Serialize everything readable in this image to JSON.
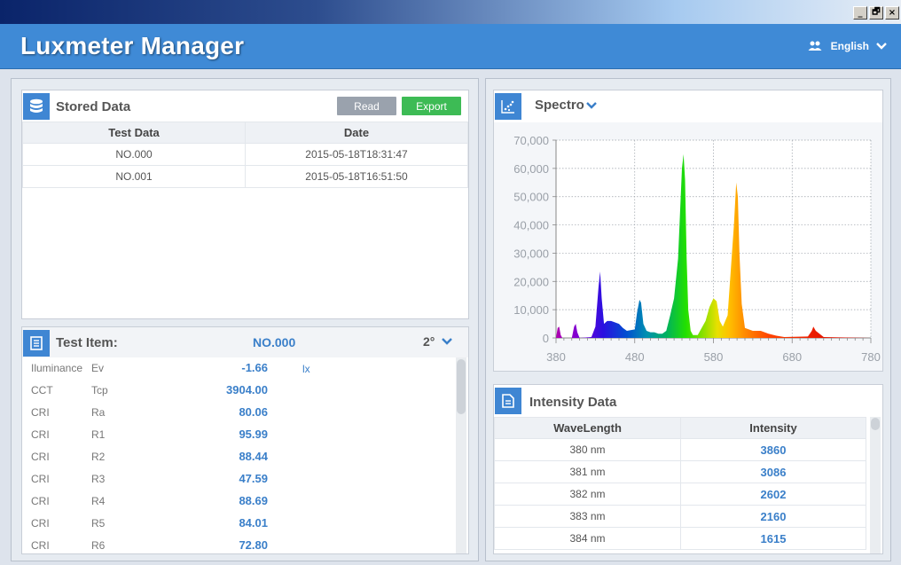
{
  "window": {
    "controls": [
      "_",
      "🗗",
      "×"
    ]
  },
  "header": {
    "title": "Luxmeter Manager",
    "language": "English"
  },
  "stored": {
    "title": "Stored Data",
    "read_label": "Read",
    "export_label": "Export",
    "columns": [
      "Test Data",
      "Date"
    ],
    "rows": [
      [
        "NO.000",
        "2015-05-18T18:31:47"
      ],
      [
        "NO.001",
        "2015-05-18T16:51:50"
      ]
    ]
  },
  "testitem": {
    "title": "Test Item:",
    "selected": "NO.000",
    "angle": "2°",
    "rows": [
      {
        "cat": "Iluminance",
        "sym": "Ev",
        "val": "-1.66",
        "unit": "lx"
      },
      {
        "cat": "CCT",
        "sym": "Tcp",
        "val": "3904.00",
        "unit": ""
      },
      {
        "cat": "CRI",
        "sym": "Ra",
        "val": "80.06",
        "unit": ""
      },
      {
        "cat": "CRI",
        "sym": "R1",
        "val": "95.99",
        "unit": ""
      },
      {
        "cat": "CRI",
        "sym": "R2",
        "val": "88.44",
        "unit": ""
      },
      {
        "cat": "CRI",
        "sym": "R3",
        "val": "47.59",
        "unit": ""
      },
      {
        "cat": "CRI",
        "sym": "R4",
        "val": "88.69",
        "unit": ""
      },
      {
        "cat": "CRI",
        "sym": "R5",
        "val": "84.01",
        "unit": ""
      },
      {
        "cat": "CRI",
        "sym": "R6",
        "val": "72.80",
        "unit": ""
      }
    ]
  },
  "spectro": {
    "title": "Spectro"
  },
  "chart_data": {
    "type": "area",
    "title": "",
    "xlabel": "",
    "ylabel": "",
    "xlim": [
      380,
      780
    ],
    "ylim": [
      0,
      70000
    ],
    "x_ticks": [
      "380",
      "480",
      "580",
      "680",
      "780"
    ],
    "y_ticks": [
      "0",
      "10,000",
      "20,000",
      "30,000",
      "40,000",
      "50,000",
      "60,000",
      "70,000"
    ],
    "grid": true,
    "series": [
      {
        "x": [
          380,
          382,
          384,
          386,
          388,
          400,
          403,
          405,
          407,
          410,
          425,
          430,
          434,
          436,
          438,
          441,
          445,
          450,
          455,
          460,
          465,
          470,
          480,
          483,
          486,
          488,
          491,
          495,
          500,
          505,
          510,
          515,
          520,
          525,
          530,
          535,
          540,
          542,
          544,
          546,
          548,
          551,
          554,
          560,
          570,
          575,
          580,
          584,
          588,
          592,
          598,
          606,
          609,
          611,
          613,
          616,
          620,
          625,
          630,
          640,
          650,
          660,
          670,
          700,
          705,
          707,
          710,
          720,
          740,
          780
        ],
        "y": [
          0,
          3500,
          4000,
          1000,
          0,
          0,
          4000,
          5000,
          2000,
          0,
          300,
          4000,
          18000,
          23500,
          14000,
          5000,
          6000,
          6000,
          5500,
          5000,
          3500,
          2500,
          3000,
          9000,
          13500,
          12500,
          5000,
          2500,
          2000,
          2000,
          1500,
          1500,
          2500,
          8000,
          14000,
          28000,
          60000,
          65000,
          56000,
          28000,
          10000,
          2500,
          1000,
          1000,
          6000,
          11000,
          14000,
          13000,
          6000,
          4000,
          8000,
          40000,
          55000,
          50000,
          30000,
          12000,
          3500,
          3000,
          2500,
          2500,
          1500,
          800,
          300,
          500,
          2500,
          4000,
          2500,
          300,
          200,
          0
        ]
      }
    ]
  },
  "intensity": {
    "title": "Intensity Data",
    "columns": [
      "WaveLength",
      "Intensity"
    ],
    "rows": [
      [
        "380 nm",
        "3860"
      ],
      [
        "381 nm",
        "3086"
      ],
      [
        "382 nm",
        "2602"
      ],
      [
        "383 nm",
        "2160"
      ],
      [
        "384 nm",
        "1615"
      ]
    ]
  }
}
